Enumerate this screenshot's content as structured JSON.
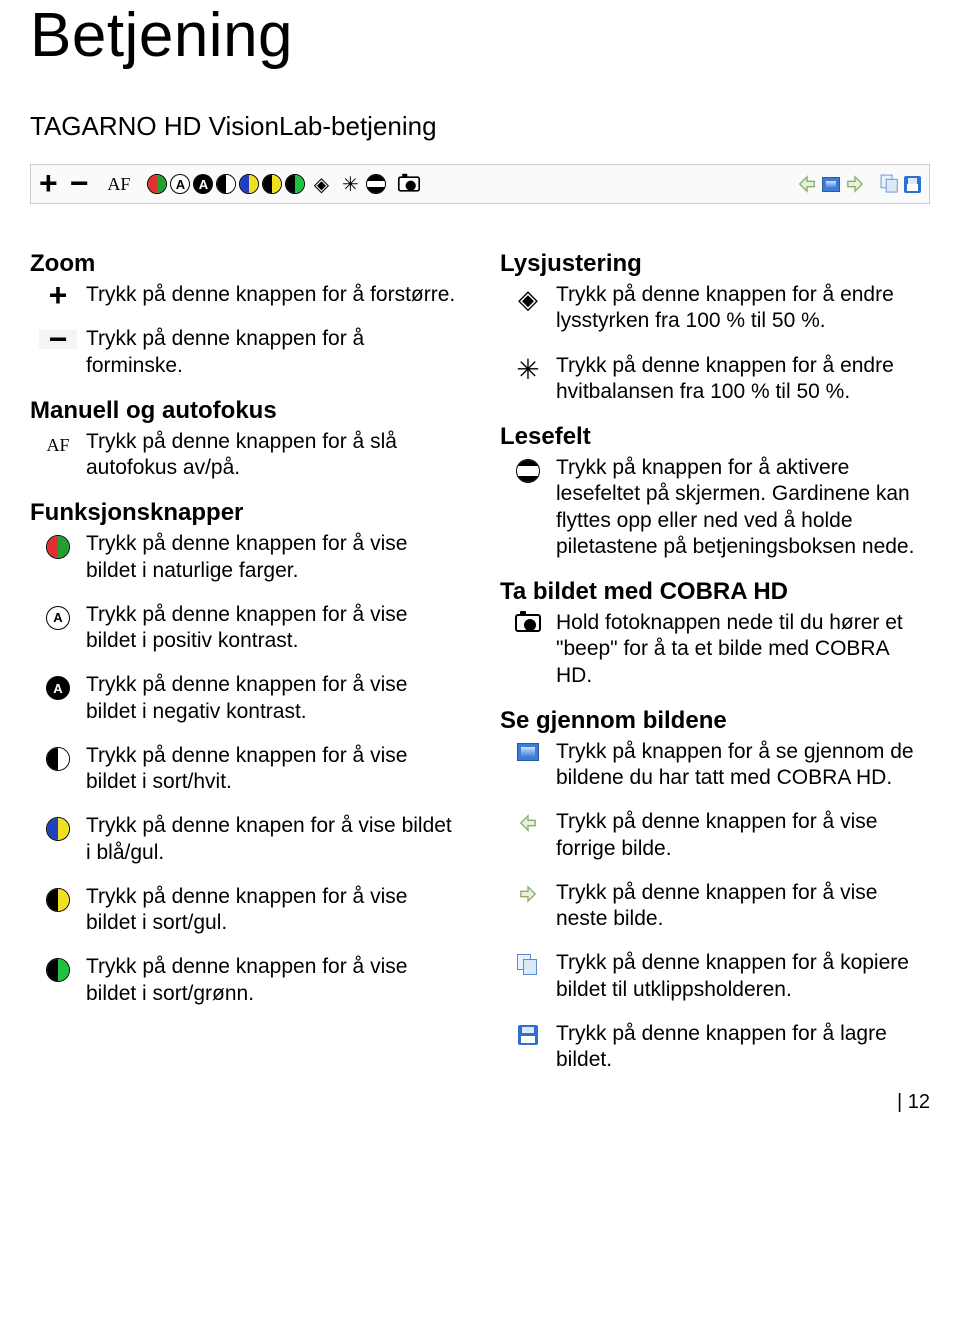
{
  "page_title": "Betjening",
  "subtitle": "TAGARNO HD VisionLab-betjening",
  "page_number": "12",
  "left": {
    "zoom": {
      "heading": "Zoom",
      "plus": "Trykk på denne knappen for å forstørre.",
      "minus": "Trykk på denne knappen for å forminske."
    },
    "focus": {
      "heading": "Manuell og autofokus",
      "af": "Trykk på denne knappen for å slå autofokus av/på."
    },
    "func": {
      "heading": "Funksjonsknapper",
      "natural": "Trykk på denne knappen for å vise bildet i naturlige farger.",
      "positive": "Trykk på denne knappen for å vise bildet i positiv kontrast.",
      "negative": "Trykk på denne knappen for å vise bildet i negativ kontrast.",
      "bw": "Trykk på denne knappen for å vise bildet i sort/hvit.",
      "blueyellow": "Trykk på denne knapen for å vise bildet i blå/gul.",
      "blackyellow": "Trykk på denne knappen for å vise bildet i sort/gul.",
      "blackgreen": "Trykk på denne knappen for å vise bildet i sort/grønn."
    }
  },
  "right": {
    "light": {
      "heading": "Lysjustering",
      "brightness": "Trykk på denne knappen for å endre lysstyrken fra 100 % til 50 %.",
      "whitebalance": "Trykk på denne knappen for å endre hvitbalansen fra 100 % til 50 %."
    },
    "readfield": {
      "heading": "Lesefelt",
      "text": "Trykk på knappen for å aktivere lesefeltet på skjermen. Gardinene kan flyttes opp eller ned ved å holde piletastene på betjeningsboksen nede."
    },
    "capture": {
      "heading": "Ta bildet med COBRA HD",
      "text": "Hold fotoknappen nede til du hører et \"beep\" for å ta et bilde med COBRA HD."
    },
    "browse": {
      "heading": "Se gjennom bildene",
      "gallery": "Trykk på knappen for å se gjennom de bildene du har tatt med COBRA HD.",
      "prev": "Trykk på denne knappen for å vise forrige bilde.",
      "next": "Trykk på denne knappen for å vise neste bilde.",
      "copy": "Trykk på denne knappen for å kopiere bildet til utklippsholderen.",
      "save": "Trykk på denne knappen for å lagre bildet."
    }
  }
}
